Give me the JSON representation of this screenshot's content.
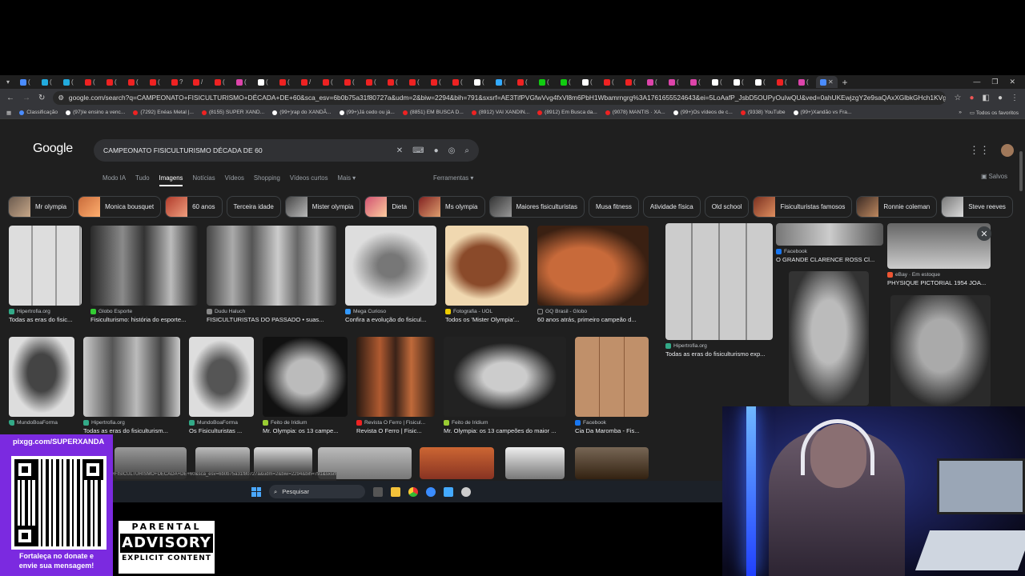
{
  "browser": {
    "tab_count_glyph": "+",
    "window_controls": [
      "—",
      "❐",
      "✕"
    ],
    "address": "google.com/search?q=CAMPEONATO+FISICULTURISMO+DÉCADA+DE+60&sca_esv=6b0b75a31f80727a&udm=2&biw=2294&bih=791&sxsrf=AE3TifPVGfwVvg4fxVl8m6PbH1Wbamrngrg%3A1761655524643&ei=5LoAafP_JsbD5OUPyOuIwQU&ved=0ahUKEwjzgY2e9saQAxXGlbkGHch1KVgQ4dUDCBI&u...",
    "bookmarks": [
      "Classificação",
      "(97)Ie ensino a venc...",
      "(7292) Enéas Metal |...",
      "(8155) SUPER XAND...",
      "(99+)rap do XANDÃ...",
      "(99+)Já cedo ou já...",
      "(8851) EM BUSCA D...",
      "(8912) VAI XANDIN...",
      "(8912) Em Busca da...",
      "(9078) MANTIS · XA...",
      "(99+)Os vídeos de c...",
      "(9338) YouTube",
      "(99+)Xandão vs Fra..."
    ],
    "all_bookmarks": "Todos os favoritos",
    "status_url": "https://www.google.com/search?q=CAMPEONATO+FISICULTURISMO+DÉCADA+DE+60&sca_esv=6b0b75a31f80727a&udm=2&biw=2294&bih=791&sxsrf=AE3TifPVGfwVvg4fxVl8m6PbH1Wbamrngrg%3A1761655524643"
  },
  "google": {
    "logo": "Google",
    "query": "CAMPEONATO FISICULTURISMO DÉCADA DE 60",
    "tabs": [
      "Modo IA",
      "Tudo",
      "Imagens",
      "Notícias",
      "Vídeos",
      "Shopping",
      "Vídeos curtos",
      "Mais ▾"
    ],
    "tools": "Ferramentas ▾",
    "saved": "Salvos",
    "chips": [
      "Mr olympia",
      "Monica bousquet",
      "60 anos",
      "Terceira idade",
      "Mister olympia",
      "Dieta",
      "Ms olympia",
      "Maiores fisiculturistas",
      "Musa fitness",
      "Atividade física",
      "Old school",
      "Fisiculturistas famosos",
      "Ronnie coleman",
      "Steve reeves"
    ],
    "results": [
      {
        "source": "Hipertrofia.org",
        "caption": "Todas as eras do fisic..."
      },
      {
        "source": "Globo Esporte",
        "caption": "Fisiculturismo: história do esporte..."
      },
      {
        "source": "Dudu Haluch",
        "caption": "FISICULTURISTAS DO PASSADO • suas..."
      },
      {
        "source": "Mega Curioso",
        "caption": "Confira a evolução do fisicul..."
      },
      {
        "source": "Fotografia - UOL",
        "caption": "Todos os 'Mister Olympia'..."
      },
      {
        "source": "GQ Brasil - Globo",
        "caption": "60 anos atrás, primeiro campeão d..."
      },
      {
        "source": "MundoBoaForma",
        "caption": "Os fisiculturistas ..."
      },
      {
        "source": "Hipertrofia.org",
        "caption": "Todas as eras do fisiculturism..."
      },
      {
        "source": "MundoBoaForma",
        "caption": "Os Fisiculturistas ..."
      },
      {
        "source": "Feito de Iridium",
        "caption": "Mr. Olympia: os 13 campe..."
      },
      {
        "source": "Revista O Ferro | Fisicul...",
        "caption": "Revista O Ferro | Fisic..."
      },
      {
        "source": "Feito de Iridium",
        "caption": "Mr. Olympia: os 13 campeões do maior ..."
      },
      {
        "source": "Facebook",
        "caption": "Cia Da Maromba - Fis..."
      }
    ],
    "side": [
      {
        "source": "Hipertrofia.org",
        "caption": "Todas as eras do fisiculturismo exp..."
      },
      {
        "source": "Facebook",
        "caption": "O GRANDE CLARENCE ROSS Cl..."
      },
      {
        "source": "eBay · Em estoque",
        "caption": "PHYSIQUE PICTORIAL 1954 JOA..."
      }
    ],
    "close_glyph": "✕"
  },
  "taskbar": {
    "search": "Pesquisar"
  },
  "overlay": {
    "pix_url": "pixgg.com/SUPERXANDA",
    "pix_msg_1": "Fortaleça no donate e",
    "pix_msg_2": "envie sua mensagem!",
    "advisory_1": "PARENTAL",
    "advisory_2": "ADVISORY",
    "advisory_3": "EXPLICIT CONTENT"
  },
  "colors": {
    "bg": "#1f1f1f",
    "chrome": "#35363a",
    "pix": "#7b2ae0"
  }
}
